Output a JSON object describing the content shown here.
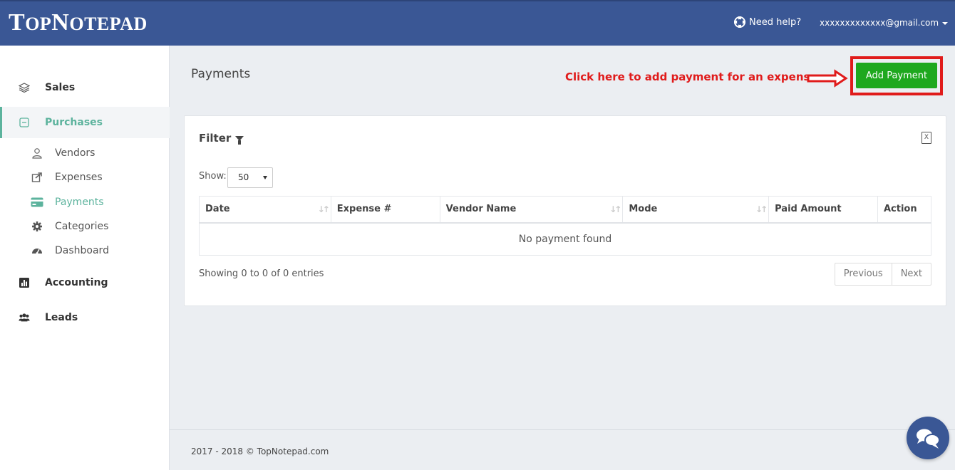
{
  "header": {
    "logo_big": "T",
    "logo_mid": "OP",
    "logo_big2": "N",
    "logo_end": "OTEPAD",
    "help_label": "Need help?",
    "user_email": "xxxxxxxxxxxxx@gmail.com"
  },
  "sidebar": {
    "sales": "Sales",
    "purchases": "Purchases",
    "vendors": "Vendors",
    "expenses": "Expenses",
    "payments": "Payments",
    "categories": "Categories",
    "dashboard": "Dashboard",
    "accounting": "Accounting",
    "leads": "Leads"
  },
  "main": {
    "title": "Payments",
    "annotation": "Click here to add payment for an expense",
    "add_button": "Add Payment",
    "filter_label": "Filter",
    "show_label": "Show:",
    "show_value": "50",
    "columns": [
      "Date",
      "Expense #",
      "Vendor Name",
      "Mode",
      "Paid Amount",
      "Action"
    ],
    "empty_message": "No payment found",
    "entries_info": "Showing 0 to 0 of 0 entries",
    "prev_label": "Previous",
    "next_label": "Next",
    "excel_glyph": "X"
  },
  "footer": {
    "copyright": "2017 - 2018 © TopNotepad.com"
  },
  "colors": {
    "header_bg": "#3a5795",
    "accent": "#5cb39d",
    "add_button": "#1ea81e",
    "annotation": "#e01b1b"
  }
}
